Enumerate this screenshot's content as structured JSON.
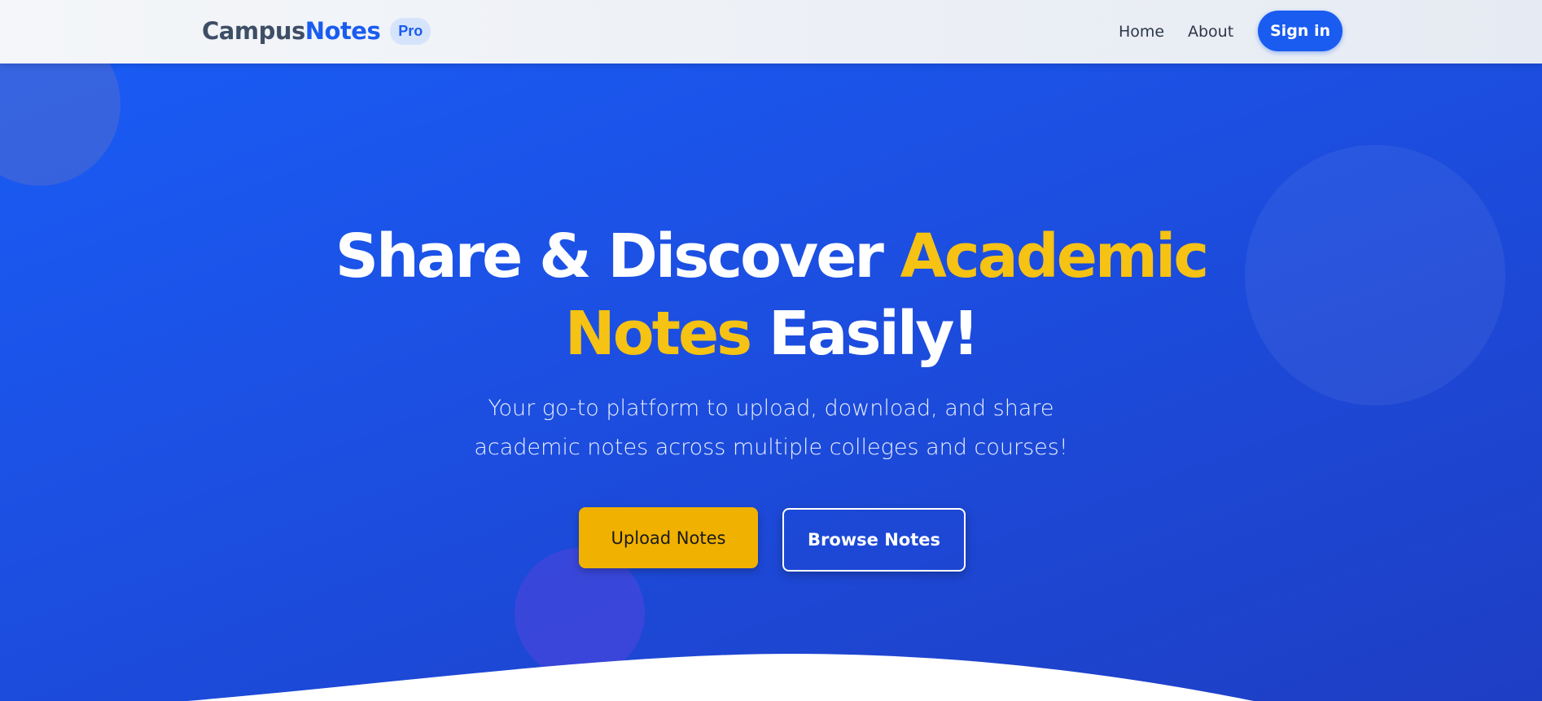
{
  "brand": {
    "part1": "Campus",
    "part2": "Notes",
    "badge": "Pro"
  },
  "nav": {
    "home": "Home",
    "about": "About",
    "signin": "Sign in"
  },
  "hero": {
    "headline_1": "Share & Discover",
    "headline_hl1": "Academic",
    "headline_hl2": "Notes",
    "headline_2": "Easily!",
    "subtitle": "Your go-to platform to upload, download, and share academic notes across multiple colleges and courses!",
    "upload_button": "Upload Notes",
    "browse_button": "Browse Notes"
  },
  "colors": {
    "primary": "#1a5cf0",
    "accent": "#f6c213",
    "upload_button": "#f0b100"
  }
}
